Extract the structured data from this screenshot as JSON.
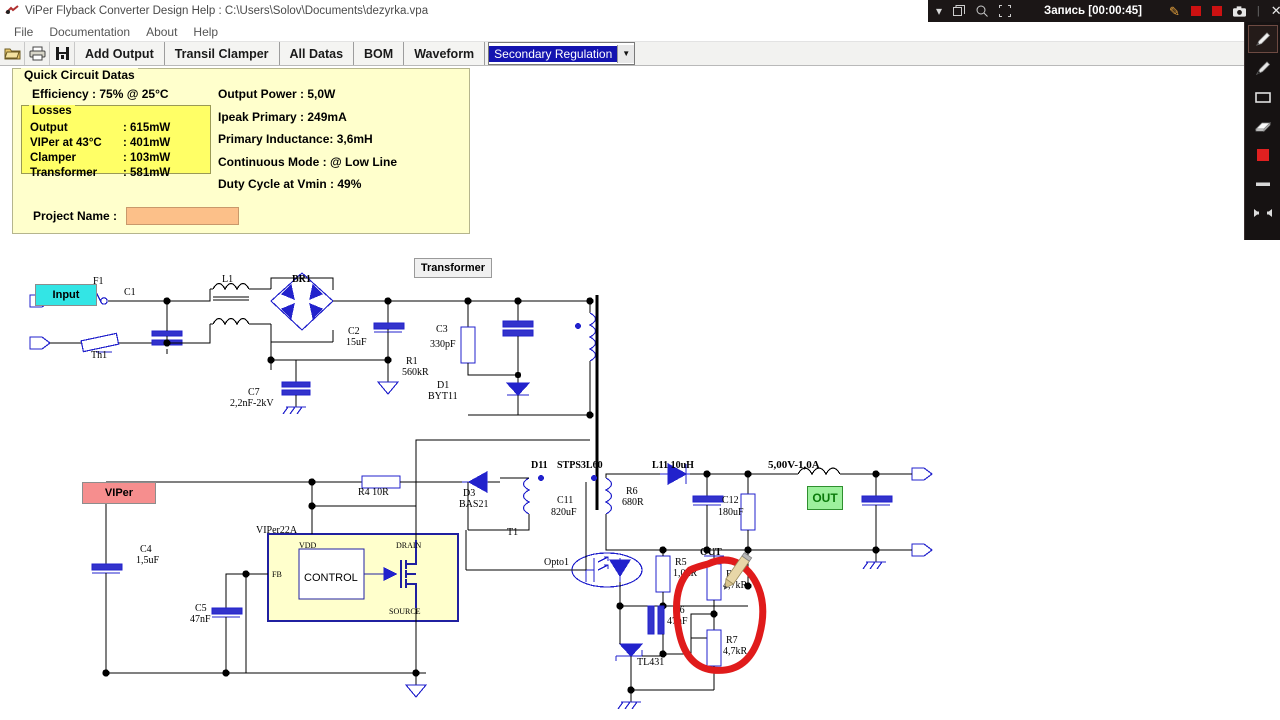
{
  "window": {
    "title": "ViPer Flyback Converter Design Help :  C:\\Users\\Solov\\Documents\\dezyrka.vpa",
    "app_icon": "app-icon"
  },
  "menu": {
    "items": [
      "File",
      "Documentation",
      "About",
      "Help"
    ]
  },
  "toolbar": {
    "icons": [
      {
        "name": "open-folder-icon"
      },
      {
        "name": "print-icon"
      },
      {
        "name": "save-icon"
      }
    ],
    "buttons": [
      "Add Output",
      "Transil Clamper",
      "All Datas",
      "BOM",
      "Waveform"
    ],
    "combo": {
      "value": "Secondary Regulation",
      "arrow": "▼"
    }
  },
  "recorder": {
    "status": "Запись [00:00:45]",
    "icons": [
      "chevron-down-icon",
      "window-icon",
      "zoom-icon",
      "crop-icon",
      "pencil-icon",
      "stop-record-icon",
      "record-icon",
      "camera-icon",
      "close-icon"
    ],
    "accent": "#cc1111"
  },
  "tools": [
    {
      "name": "pencil-tool",
      "selected": true
    },
    {
      "name": "marker-tool",
      "selected": false
    },
    {
      "name": "rectangle-tool",
      "selected": false
    },
    {
      "name": "eraser-tool",
      "selected": false
    },
    {
      "name": "color-swatch-tool",
      "selected": false,
      "color": "#e02020"
    },
    {
      "name": "line-width-tool",
      "selected": false
    },
    {
      "name": "undo-redo-tool",
      "selected": false
    }
  ],
  "quick_circuit_datas": {
    "title": "Quick Circuit Datas",
    "efficiency": "Efficiency : 75% @ 25°C",
    "losses": {
      "title": "Losses",
      "rows": [
        {
          "key": "Output",
          "value": ": 615mW"
        },
        {
          "key": "VIPer at 43°C",
          "value": ": 401mW"
        },
        {
          "key": "Clamper",
          "value": ": 103mW"
        },
        {
          "key": "Transformer",
          "value": ": 581mW"
        }
      ]
    },
    "right_column": [
      "Output Power : 5,0W",
      "Ipeak Primary : 249mA",
      "Primary Inductance: 3,6mH",
      "Continuous Mode : @ Low Line",
      "Duty Cycle at Vmin : 49%"
    ],
    "project_name_label": "Project Name :",
    "project_name_value": "",
    "panel_color": "#ffffcc",
    "losses_color": "#ffff66",
    "input_color": "#fcc089"
  },
  "schematic": {
    "badges": {
      "input": {
        "text": "Input",
        "color": "#33e5e5"
      },
      "viper": {
        "text": "VIPer",
        "color": "#f68e8e"
      },
      "transformer": {
        "text": "Transformer",
        "color": "#f0f0f0"
      },
      "out": {
        "text": "OUT",
        "color": "#9cf09c"
      }
    },
    "labels": {
      "f1": "F1",
      "th1": "Th1",
      "c1": "C1",
      "l1": "L1",
      "br1": "BR1",
      "c2": "C2",
      "c2v": "15uF",
      "c3": "C3",
      "c3v": "330pF",
      "r1": "R1",
      "r1v": "560kR",
      "d1": "D1",
      "d1v": "BYT11",
      "c7": "C7",
      "c7v": "2,2nF-2kV",
      "r4": "R4 10R",
      "d3": "D3",
      "d3v": "BAS21",
      "t1": "T1",
      "d11": "D11",
      "d11v": "STPS3L60",
      "c11": "C11",
      "c11v": "820uF",
      "r6": "R6",
      "r6v": "680R",
      "l11": "L11 10uH",
      "c12": "C12",
      "c12v": "180uF",
      "vout": "5,00V-1,0A",
      "viper22a": "VIPer22A",
      "vdd": "VDD",
      "drain": "DRAIN",
      "fb": "FB",
      "source": "SOURCE",
      "control": "CONTROL",
      "c4": "C4",
      "c4v": "1,5uF",
      "c5": "C5",
      "c5v": "47nF",
      "opto1": "Opto1",
      "r5": "R5",
      "r5v": "1,0kR",
      "c6": "C6",
      "c6v": "47nF",
      "tl431": "TL431",
      "out_node": "OUT",
      "r8": "R8",
      "r8v": "4,7kR",
      "r7": "R7",
      "r7v": "4,7kR"
    },
    "annotation": {
      "name": "red-circle-annotation",
      "color": "#e01b1b"
    },
    "wire_color": "#000000",
    "symbol_color": "#2222cc"
  }
}
